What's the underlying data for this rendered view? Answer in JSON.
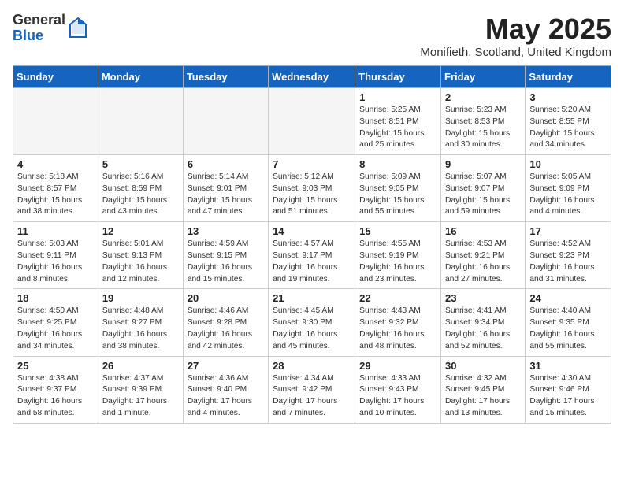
{
  "logo": {
    "general": "General",
    "blue": "Blue"
  },
  "title": "May 2025",
  "location": "Monifieth, Scotland, United Kingdom",
  "days_of_week": [
    "Sunday",
    "Monday",
    "Tuesday",
    "Wednesday",
    "Thursday",
    "Friday",
    "Saturday"
  ],
  "weeks": [
    [
      {
        "day": "",
        "detail": ""
      },
      {
        "day": "",
        "detail": ""
      },
      {
        "day": "",
        "detail": ""
      },
      {
        "day": "",
        "detail": ""
      },
      {
        "day": "1",
        "detail": "Sunrise: 5:25 AM\nSunset: 8:51 PM\nDaylight: 15 hours\nand 25 minutes."
      },
      {
        "day": "2",
        "detail": "Sunrise: 5:23 AM\nSunset: 8:53 PM\nDaylight: 15 hours\nand 30 minutes."
      },
      {
        "day": "3",
        "detail": "Sunrise: 5:20 AM\nSunset: 8:55 PM\nDaylight: 15 hours\nand 34 minutes."
      }
    ],
    [
      {
        "day": "4",
        "detail": "Sunrise: 5:18 AM\nSunset: 8:57 PM\nDaylight: 15 hours\nand 38 minutes."
      },
      {
        "day": "5",
        "detail": "Sunrise: 5:16 AM\nSunset: 8:59 PM\nDaylight: 15 hours\nand 43 minutes."
      },
      {
        "day": "6",
        "detail": "Sunrise: 5:14 AM\nSunset: 9:01 PM\nDaylight: 15 hours\nand 47 minutes."
      },
      {
        "day": "7",
        "detail": "Sunrise: 5:12 AM\nSunset: 9:03 PM\nDaylight: 15 hours\nand 51 minutes."
      },
      {
        "day": "8",
        "detail": "Sunrise: 5:09 AM\nSunset: 9:05 PM\nDaylight: 15 hours\nand 55 minutes."
      },
      {
        "day": "9",
        "detail": "Sunrise: 5:07 AM\nSunset: 9:07 PM\nDaylight: 15 hours\nand 59 minutes."
      },
      {
        "day": "10",
        "detail": "Sunrise: 5:05 AM\nSunset: 9:09 PM\nDaylight: 16 hours\nand 4 minutes."
      }
    ],
    [
      {
        "day": "11",
        "detail": "Sunrise: 5:03 AM\nSunset: 9:11 PM\nDaylight: 16 hours\nand 8 minutes."
      },
      {
        "day": "12",
        "detail": "Sunrise: 5:01 AM\nSunset: 9:13 PM\nDaylight: 16 hours\nand 12 minutes."
      },
      {
        "day": "13",
        "detail": "Sunrise: 4:59 AM\nSunset: 9:15 PM\nDaylight: 16 hours\nand 15 minutes."
      },
      {
        "day": "14",
        "detail": "Sunrise: 4:57 AM\nSunset: 9:17 PM\nDaylight: 16 hours\nand 19 minutes."
      },
      {
        "day": "15",
        "detail": "Sunrise: 4:55 AM\nSunset: 9:19 PM\nDaylight: 16 hours\nand 23 minutes."
      },
      {
        "day": "16",
        "detail": "Sunrise: 4:53 AM\nSunset: 9:21 PM\nDaylight: 16 hours\nand 27 minutes."
      },
      {
        "day": "17",
        "detail": "Sunrise: 4:52 AM\nSunset: 9:23 PM\nDaylight: 16 hours\nand 31 minutes."
      }
    ],
    [
      {
        "day": "18",
        "detail": "Sunrise: 4:50 AM\nSunset: 9:25 PM\nDaylight: 16 hours\nand 34 minutes."
      },
      {
        "day": "19",
        "detail": "Sunrise: 4:48 AM\nSunset: 9:27 PM\nDaylight: 16 hours\nand 38 minutes."
      },
      {
        "day": "20",
        "detail": "Sunrise: 4:46 AM\nSunset: 9:28 PM\nDaylight: 16 hours\nand 42 minutes."
      },
      {
        "day": "21",
        "detail": "Sunrise: 4:45 AM\nSunset: 9:30 PM\nDaylight: 16 hours\nand 45 minutes."
      },
      {
        "day": "22",
        "detail": "Sunrise: 4:43 AM\nSunset: 9:32 PM\nDaylight: 16 hours\nand 48 minutes."
      },
      {
        "day": "23",
        "detail": "Sunrise: 4:41 AM\nSunset: 9:34 PM\nDaylight: 16 hours\nand 52 minutes."
      },
      {
        "day": "24",
        "detail": "Sunrise: 4:40 AM\nSunset: 9:35 PM\nDaylight: 16 hours\nand 55 minutes."
      }
    ],
    [
      {
        "day": "25",
        "detail": "Sunrise: 4:38 AM\nSunset: 9:37 PM\nDaylight: 16 hours\nand 58 minutes."
      },
      {
        "day": "26",
        "detail": "Sunrise: 4:37 AM\nSunset: 9:39 PM\nDaylight: 17 hours\nand 1 minute."
      },
      {
        "day": "27",
        "detail": "Sunrise: 4:36 AM\nSunset: 9:40 PM\nDaylight: 17 hours\nand 4 minutes."
      },
      {
        "day": "28",
        "detail": "Sunrise: 4:34 AM\nSunset: 9:42 PM\nDaylight: 17 hours\nand 7 minutes."
      },
      {
        "day": "29",
        "detail": "Sunrise: 4:33 AM\nSunset: 9:43 PM\nDaylight: 17 hours\nand 10 minutes."
      },
      {
        "day": "30",
        "detail": "Sunrise: 4:32 AM\nSunset: 9:45 PM\nDaylight: 17 hours\nand 13 minutes."
      },
      {
        "day": "31",
        "detail": "Sunrise: 4:30 AM\nSunset: 9:46 PM\nDaylight: 17 hours\nand 15 minutes."
      }
    ]
  ]
}
